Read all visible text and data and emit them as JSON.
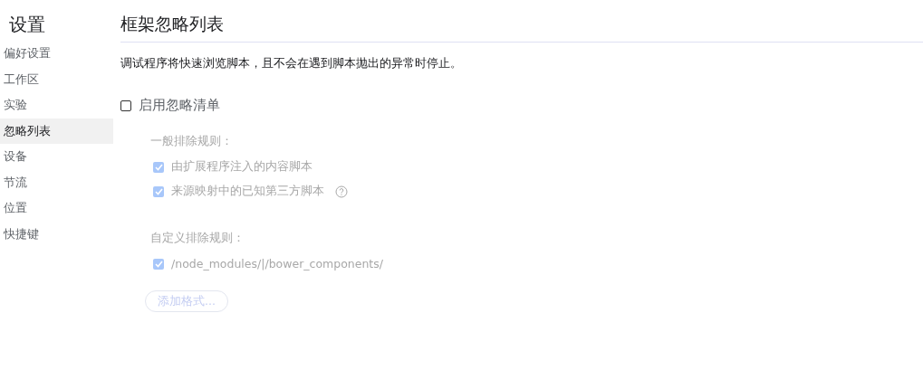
{
  "sidebar": {
    "title": "设置",
    "items": [
      {
        "label": "偏好设置",
        "selected": false
      },
      {
        "label": "工作区",
        "selected": false
      },
      {
        "label": "实验",
        "selected": false
      },
      {
        "label": "忽略列表",
        "selected": true
      },
      {
        "label": "设备",
        "selected": false
      },
      {
        "label": "节流",
        "selected": false
      },
      {
        "label": "位置",
        "selected": false
      },
      {
        "label": "快捷键",
        "selected": false
      }
    ]
  },
  "page": {
    "title": "框架忽略列表",
    "description": "调试程序将快速浏览脚本，且不会在遇到脚本抛出的异常时停止。",
    "enable": {
      "label": "启用忽略清单",
      "checked": false
    },
    "groups": [
      {
        "heading": "一般排除规则：",
        "rules": [
          {
            "label": "由扩展程序注入的内容脚本",
            "checked": true,
            "disabled": true,
            "help": false
          },
          {
            "label": "来源映射中的已知第三方脚本",
            "checked": true,
            "disabled": true,
            "help": true
          }
        ]
      },
      {
        "heading": "自定义排除规则：",
        "rules": [
          {
            "label": "/node_modules/|/bower_components/",
            "checked": true,
            "disabled": true,
            "help": false
          }
        ]
      }
    ],
    "add_button": {
      "label": "添加格式...",
      "disabled": true
    }
  }
}
